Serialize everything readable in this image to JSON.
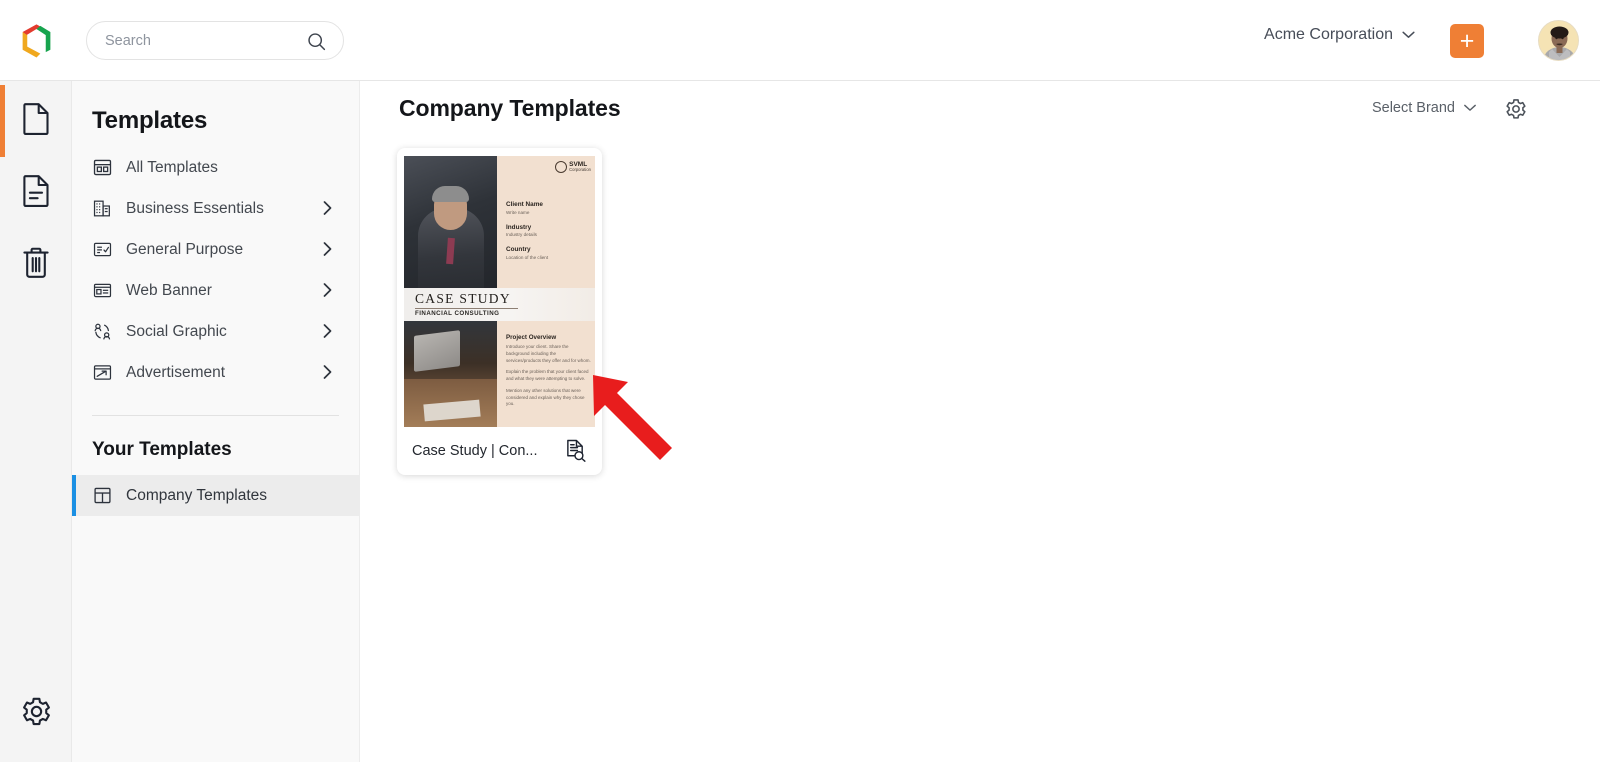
{
  "topbar": {
    "logo_name": "app-logo",
    "search": {
      "value": "",
      "placeholder": "Search"
    },
    "organization": "Acme Corporation",
    "add_label": "+",
    "avatar_alt": "User avatar"
  },
  "rail": {
    "items": [
      {
        "icon": "blank-document-icon",
        "name": "designs",
        "active": true
      },
      {
        "icon": "document-lines-icon",
        "name": "documents",
        "active": false
      },
      {
        "icon": "trash-icon",
        "name": "trash",
        "active": false
      }
    ],
    "bottom": {
      "icon": "gear-icon",
      "name": "settings"
    }
  },
  "sidebar": {
    "title": "Templates",
    "items": [
      {
        "label": "All Templates",
        "icon": "grid-layout-icon",
        "expandable": false
      },
      {
        "label": "Business Essentials",
        "icon": "building-icon",
        "expandable": true
      },
      {
        "label": "General Purpose",
        "icon": "checklist-icon",
        "expandable": true
      },
      {
        "label": "Web Banner",
        "icon": "web-banner-icon",
        "expandable": true
      },
      {
        "label": "Social Graphic",
        "icon": "social-graphic-icon",
        "expandable": true
      },
      {
        "label": "Advertisement",
        "icon": "advertisement-icon",
        "expandable": true
      }
    ],
    "section_title": "Your Templates",
    "your_items": [
      {
        "label": "Company Templates",
        "icon": "company-templates-icon",
        "selected": true
      }
    ]
  },
  "main": {
    "page_title": "Company Templates",
    "brand_select": "Select Brand",
    "settings_icon": "gear-icon"
  },
  "card": {
    "name": "Case Study | Con...",
    "preview_icon": "document-preview-icon",
    "thumbnail": {
      "logo_brand": "SVML",
      "logo_sub": "Corporation",
      "heading": "CASE STUDY",
      "subheading": "FINANCIAL CONSULTING",
      "fields": [
        {
          "label": "Client Name",
          "value": "Write name"
        },
        {
          "label": "Industry",
          "value": "Industry details"
        },
        {
          "label": "Country",
          "value": "Location of the client"
        }
      ],
      "overview_title": "Project Overview",
      "overview_paragraphs": [
        "Introduce your client. Share the background including the services/products they offer and for whom.",
        "Explain the problem that your client faced and what they were attempting to solve.",
        "Mention any other solutions that were considered and explain why they chose you."
      ]
    }
  },
  "annotation": {
    "type": "arrow",
    "color": "#e81d1d",
    "points_to": "template-card"
  },
  "colors": {
    "accent_orange": "#ef7f35",
    "selected_blue": "#1a8fe3",
    "sidebar_bg": "#f9f9f9",
    "rail_bg": "#f4f4f4",
    "thumb_beige": "#f2e0d0"
  }
}
